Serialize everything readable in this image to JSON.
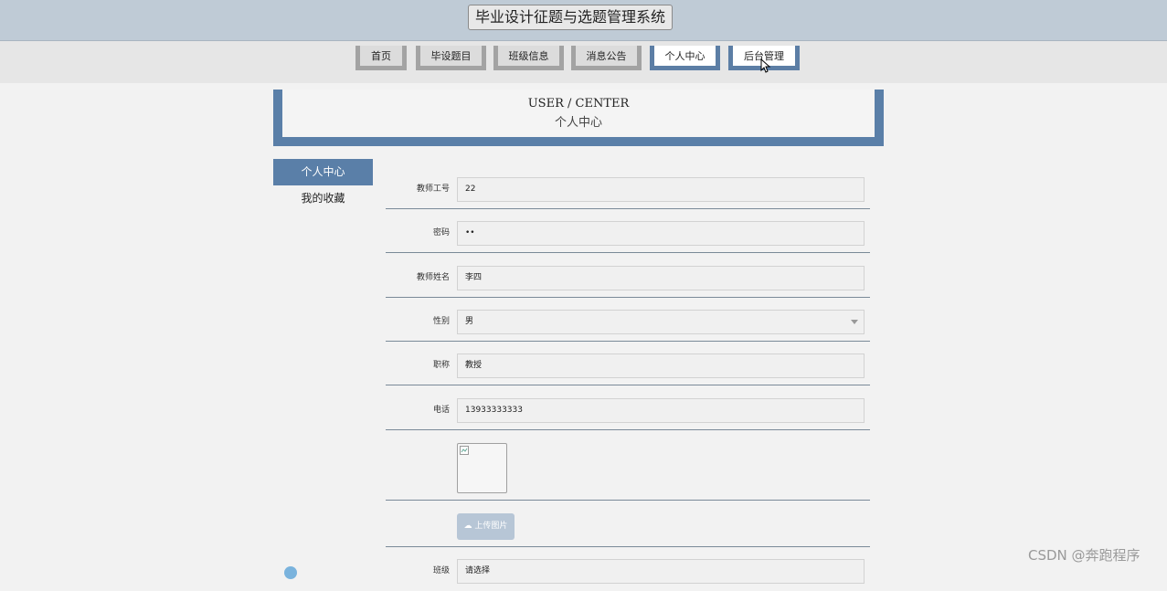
{
  "header": {
    "site_title": "毕业设计征题与选题管理系统"
  },
  "nav": {
    "items": [
      {
        "label": "首页",
        "style": "gray"
      },
      {
        "label": "毕设题目",
        "style": "gray"
      },
      {
        "label": "班级信息",
        "style": "gray"
      },
      {
        "label": "消息公告",
        "style": "gray"
      },
      {
        "label": "个人中心",
        "style": "blue"
      },
      {
        "label": "后台管理",
        "style": "blue"
      }
    ]
  },
  "banner": {
    "title_en": "USER / CENTER",
    "title_cn": "个人中心"
  },
  "sidemenu": {
    "items": [
      {
        "label": "个人中心",
        "active": true
      },
      {
        "label": "我的收藏",
        "active": false
      }
    ]
  },
  "form": {
    "teacher_id": {
      "label": "教师工号",
      "value": "22"
    },
    "password": {
      "label": "密码",
      "value": "••"
    },
    "teacher_name": {
      "label": "教师姓名",
      "value": "李四"
    },
    "gender": {
      "label": "性别",
      "value": "男"
    },
    "title": {
      "label": "职称",
      "value": "教授"
    },
    "phone": {
      "label": "电话",
      "value": "13933333333"
    },
    "upload_label": "上传图片",
    "class": {
      "label": "班级",
      "value": "请选择"
    }
  },
  "watermark": "CSDN @奔跑程序",
  "colors": {
    "accent": "#5a7fa8",
    "topbar": "#bfcbd6",
    "background": "#f2f2f2"
  }
}
